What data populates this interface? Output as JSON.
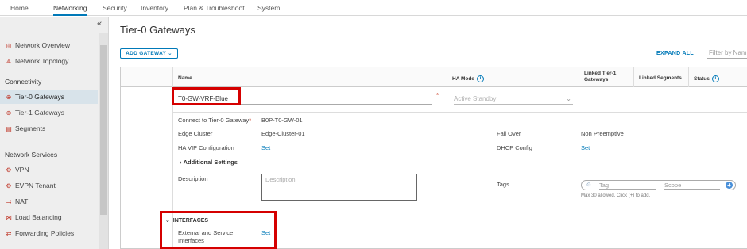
{
  "topnav": {
    "tabs": [
      "Home",
      "Networking",
      "Security",
      "Inventory",
      "Plan & Troubleshoot",
      "System"
    ],
    "active": "Networking"
  },
  "sidebar": {
    "collapse_icon": "«",
    "items_top": [
      {
        "label": "Network Overview",
        "icon": "network-overview-icon"
      },
      {
        "label": "Network Topology",
        "icon": "topology-icon"
      }
    ],
    "section_connectivity": "Connectivity",
    "connectivity": [
      {
        "label": "Tier-0 Gateways",
        "icon": "tier0-gateway-icon",
        "active": true
      },
      {
        "label": "Tier-1 Gateways",
        "icon": "tier1-gateway-icon"
      },
      {
        "label": "Segments",
        "icon": "segments-icon"
      }
    ],
    "section_services": "Network Services",
    "services": [
      {
        "label": "VPN",
        "icon": "vpn-icon"
      },
      {
        "label": "EVPN Tenant",
        "icon": "evpn-icon"
      },
      {
        "label": "NAT",
        "icon": "nat-icon"
      },
      {
        "label": "Load Balancing",
        "icon": "load-balancing-icon"
      },
      {
        "label": "Forwarding Policies",
        "icon": "forwarding-policies-icon"
      }
    ]
  },
  "main": {
    "title": "Tier-0 Gateways",
    "add_gateway": "ADD GATEWAY ⌄",
    "expand_all": "EXPAND ALL",
    "filter_placeholder": "Filter by Nam",
    "columns": {
      "name": "Name",
      "ha_mode": "HA Mode",
      "linked_tier1": "Linked Tier-1 Gateways",
      "linked_segments": "Linked Segments",
      "status": "Status"
    },
    "row": {
      "name_value": "T0-GW-VRF-Blue",
      "ha_mode_placeholder": "Active Standby",
      "connect_label": "Connect to Tier-0 Gateway",
      "connect_value": "B0P-T0-GW-01",
      "edge_cluster_label": "Edge Cluster",
      "edge_cluster_value": "Edge-Cluster-01",
      "fail_over_label": "Fail Over",
      "fail_over_value": "Non Preemptive",
      "ha_vip_label": "HA VIP Configuration",
      "ha_vip_link": "Set",
      "dhcp_label": "DHCP Config",
      "dhcp_link": "Set",
      "additional_settings": "Additional Settings",
      "description_label": "Description",
      "description_placeholder": "Description",
      "tags_label": "Tags",
      "tag_placeholder": "Tag",
      "scope_placeholder": "Scope",
      "tags_note": "Max 30 allowed. Click (+) to add.",
      "interfaces_heading": "INTERFACES",
      "ext_service_label": "External and Service Interfaces",
      "ext_service_link": "Set"
    }
  },
  "colors": {
    "accent": "#0079b8",
    "highlight": "#d50000",
    "required": "#c21d00"
  }
}
